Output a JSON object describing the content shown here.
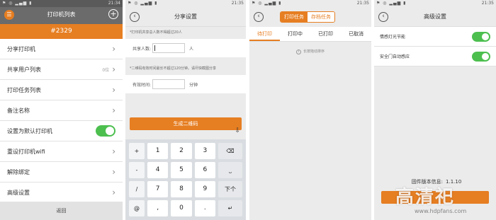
{
  "panel1": {
    "status_time": "21:34",
    "status_icons": "⚑ ◎ ▂▄▆ ▮",
    "title": "打印机列表",
    "printer_id": "#2329",
    "rows": [
      {
        "label": "分享打印机"
      },
      {
        "label": "共享用户列表",
        "count": "0位"
      },
      {
        "label": "打印任务列表"
      },
      {
        "label": "备注名称"
      },
      {
        "label": "设置为默认打印机"
      },
      {
        "label": "重设打印机wifi"
      },
      {
        "label": "解除绑定"
      },
      {
        "label": "高级设置"
      }
    ],
    "back_label": "返回"
  },
  "panel2": {
    "status_time": "21:35",
    "status_icons": "⚑ ◎ ▂▄▆ ▮",
    "title": "分享设置",
    "note1": "*打印机共享总人数不得超过20人",
    "field1_label": "共享人数:",
    "field1_unit": "人",
    "note2": "*二维码有效时间最长不超过120分钟。请尽快截图分享",
    "field2_label": "有效时间:",
    "field2_unit": "分钟",
    "generate_label": "生成二维码",
    "kb_hide": "⇩",
    "keyboard": {
      "rows": [
        {
          "sym": "+",
          "keys": [
            "1",
            "2",
            "3"
          ],
          "fn": "⌫"
        },
        {
          "sym": "-",
          "keys": [
            "4",
            "5",
            "6"
          ],
          "fn": "⎵"
        },
        {
          "sym": "/",
          "keys": [
            "7",
            "8",
            "9"
          ],
          "fn": "下个"
        },
        {
          "sym": "@",
          "keys": [
            ",",
            "0",
            "."
          ],
          "fn": "↵"
        }
      ],
      "extra_sym": ":"
    }
  },
  "panel3": {
    "status_time": "21:35",
    "status_icons": "⚑ ◎ ▂▄▆ ▮",
    "seg_on": "打印任务",
    "seg_off": "存档任务",
    "tabs": [
      "待打印",
      "打印中",
      "已打印",
      "已取消"
    ],
    "hint": "长按拖动排序"
  },
  "panel4": {
    "status_time": "21:35",
    "status_icons": "⚑ ◎ ▂▄▆ ▮",
    "title": "高级设置",
    "rows": [
      {
        "label": "情感灯光节能"
      },
      {
        "label": "安全门自动感应"
      }
    ],
    "firmware_label": "固件版本信息:",
    "firmware_value": "1.1.10"
  },
  "watermark": {
    "text": "高清祀",
    "url": "www.hdpfans.com"
  },
  "colors": {
    "accent": "#e67e22",
    "toggle_on": "#4cbf4f",
    "header_dark": "#6b6b6b"
  }
}
